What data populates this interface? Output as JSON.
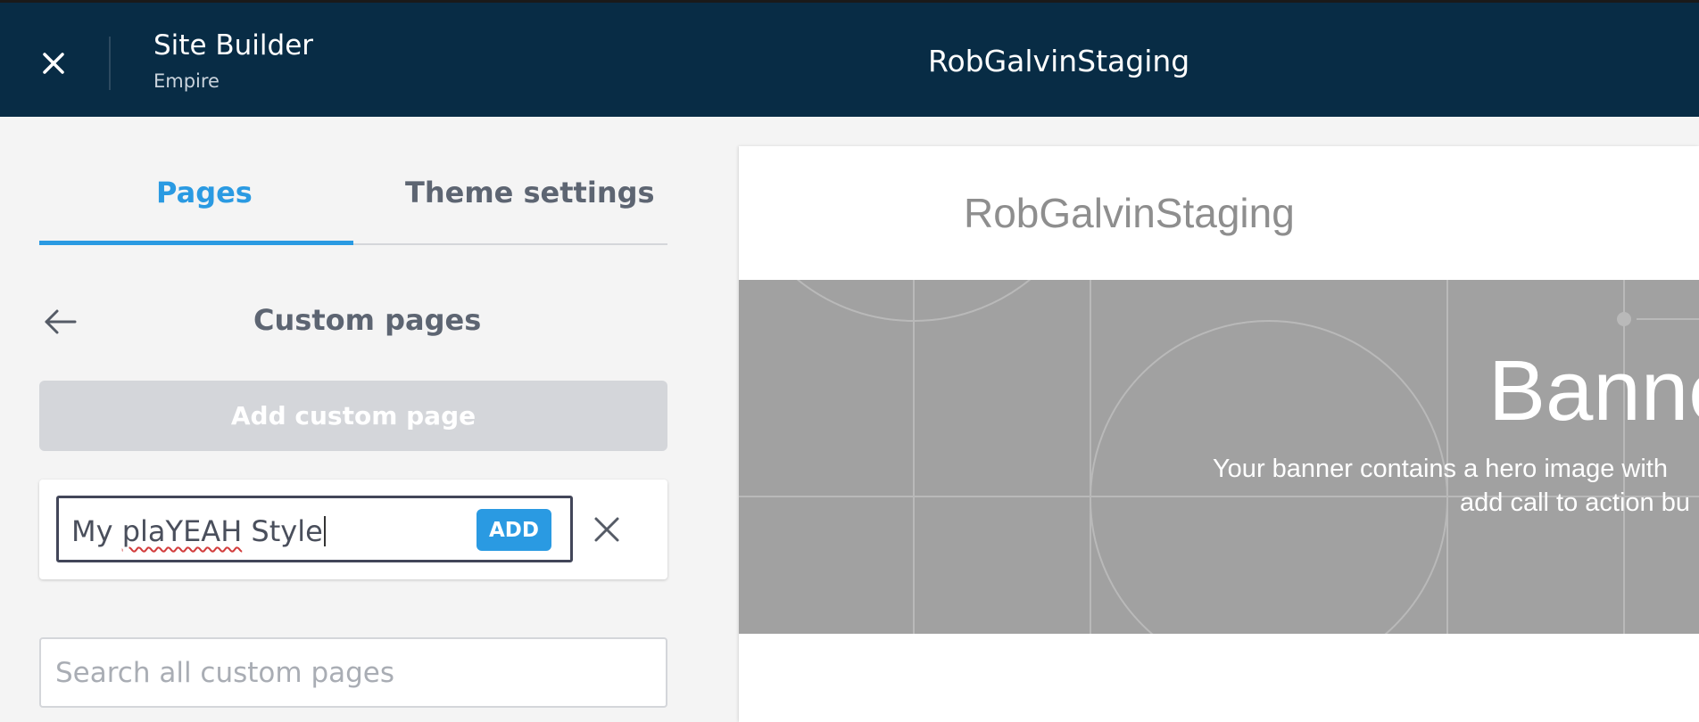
{
  "header": {
    "app_title": "Site Builder",
    "app_subtitle": "Empire",
    "site_name": "RobGalvinStaging",
    "close_icon": "close-icon"
  },
  "tabs": [
    {
      "label": "Pages",
      "active": true
    },
    {
      "label": "Theme settings",
      "active": false
    }
  ],
  "section": {
    "back_icon": "arrow-left-icon",
    "title": "Custom pages"
  },
  "add_custom_page": {
    "label": "Add custom page",
    "disabled": true
  },
  "new_page": {
    "value_prefix": "My ",
    "value_misspelled": "plaYEAH",
    "value_suffix": " Style",
    "add_label": "ADD",
    "cancel_icon": "close-icon"
  },
  "search": {
    "placeholder": "Search all custom pages",
    "value": ""
  },
  "preview": {
    "site_name": "RobGalvinStaging",
    "banner_title": "Banne",
    "banner_desc_line1": "Your banner contains a hero image with",
    "banner_desc_line2": "add call to action bu"
  },
  "colors": {
    "header_bg": "#082c45",
    "accent": "#2a9ae2",
    "banner_bg": "#a1a1a1"
  }
}
